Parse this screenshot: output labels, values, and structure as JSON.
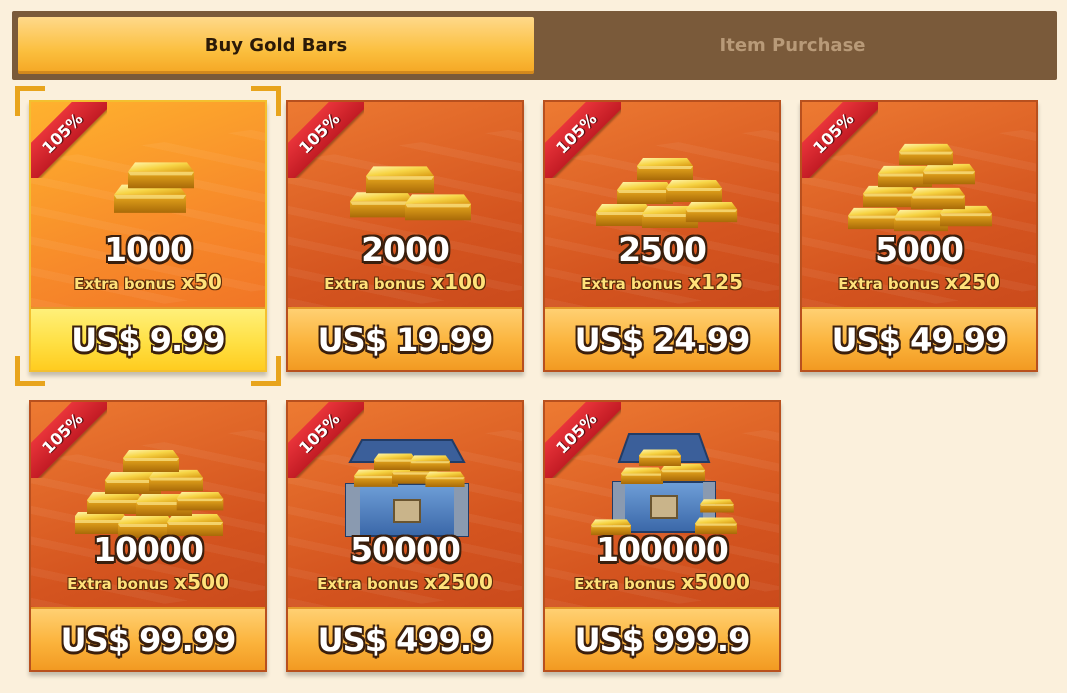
{
  "tabs": [
    {
      "label": "Buy Gold Bars",
      "active": true
    },
    {
      "label": "Item Purchase",
      "active": false
    }
  ],
  "colors": {
    "tab_bar": "#7a5a3a",
    "card": "#d4541f",
    "ribbon": "#e9343a",
    "price_bar": "#fbb33c",
    "selected_frame": "#e8a41c"
  },
  "products": [
    {
      "badge": "105%",
      "amount": "1000",
      "bonus_label": "Extra bonus",
      "bonus_mult": "x50",
      "price": "US$ 9.99",
      "icon": "gold-bars-small-icon",
      "selected": true
    },
    {
      "badge": "105%",
      "amount": "2000",
      "bonus_label": "Extra bonus",
      "bonus_mult": "x100",
      "price": "US$ 19.99",
      "icon": "gold-bars-icon"
    },
    {
      "badge": "105%",
      "amount": "2500",
      "bonus_label": "Extra bonus",
      "bonus_mult": "x125",
      "price": "US$ 24.99",
      "icon": "gold-bars-stack-icon"
    },
    {
      "badge": "105%",
      "amount": "5000",
      "bonus_label": "Extra bonus",
      "bonus_mult": "x250",
      "price": "US$ 49.99",
      "icon": "gold-bars-pile-icon"
    },
    {
      "badge": "105%",
      "amount": "10000",
      "bonus_label": "Extra bonus",
      "bonus_mult": "x500",
      "price": "US$ 99.99",
      "icon": "gold-bars-heap-icon"
    },
    {
      "badge": "105%",
      "amount": "50000",
      "bonus_label": "Extra bonus",
      "bonus_mult": "x2500",
      "price": "US$ 499.9",
      "icon": "gold-chest-icon"
    },
    {
      "badge": "105%",
      "amount": "100000",
      "bonus_label": "Extra bonus",
      "bonus_mult": "x5000",
      "price": "US$ 999.9",
      "icon": "gold-chest-large-icon"
    }
  ]
}
